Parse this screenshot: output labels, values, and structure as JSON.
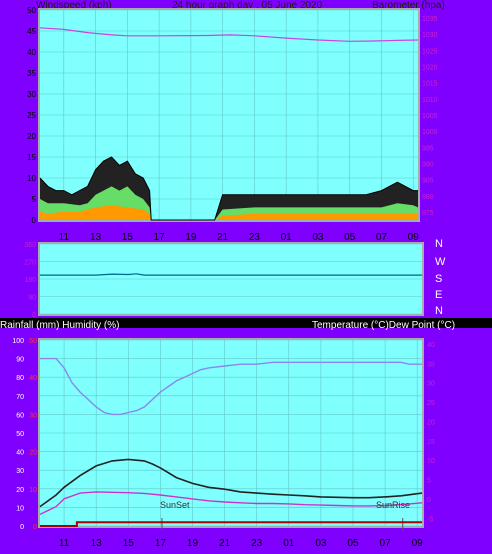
{
  "header": {
    "left": "Windspeed (kph)",
    "center": "24 hour graph day : 05 June 2020",
    "right": "Barometer (hpa)"
  },
  "dir_letters": [
    "N",
    "W",
    "S",
    "E",
    "N"
  ],
  "mid_header": {
    "left": "Rainfall (mm)  Humidity (%)",
    "right": "Temperature (°C)Dew Point (°C)"
  },
  "markers": {
    "sunset": "SunSet",
    "sunrise": "SunRise"
  },
  "colors": {
    "plot_bg": "#80ffff",
    "frame_bg": "#8000ff",
    "barometer": "#cc44dd",
    "wind_gust": "#000000",
    "wind_avg_green": "#66dd66",
    "wind_avg_orange": "#ff9900",
    "humidity": "#8888ee",
    "temperature": "#222222",
    "dewpoint": "#cc33cc",
    "rain": "#aa0000"
  },
  "chart_data": [
    {
      "type": "line",
      "title": "24 hour graph day : 05 June 2020",
      "ylabel": "Windspeed (kph)",
      "y2label": "Barometer (hpa)",
      "x_ticks": [
        "11",
        "13",
        "15",
        "17",
        "19",
        "21",
        "23",
        "01",
        "03",
        "05",
        "07",
        "09"
      ],
      "y_ticks": [
        "50",
        "45",
        "40",
        "35",
        "30",
        "25",
        "20",
        "15",
        "10",
        "5",
        "0"
      ],
      "y2_ticks": [
        "1035",
        "1030",
        "1025",
        "1020",
        "1015",
        "1010",
        "1005",
        "1000",
        "995",
        "990",
        "985",
        "980",
        "975"
      ],
      "ylim": [
        0,
        50
      ],
      "y2lim": [
        972.5,
        1037.5
      ],
      "grid": true,
      "series": [
        {
          "key": "barometer",
          "axis": "right",
          "x": [
            9.5,
            11,
            12.5,
            14,
            15,
            17,
            20,
            21.5,
            23,
            1,
            3,
            5,
            6.5,
            8,
            9.3
          ],
          "y": [
            1032,
            1031.5,
            1030.5,
            1029.8,
            1029.5,
            1029.5,
            1029.6,
            1029.8,
            1029.5,
            1028.8,
            1028.2,
            1027.8,
            1027.9,
            1028.1,
            1028.2
          ]
        },
        {
          "key": "wind_gust",
          "axis": "left",
          "x": [
            9.5,
            10,
            10.5,
            11,
            11.5,
            12,
            12.5,
            13,
            13.5,
            14,
            14.5,
            15,
            15.5,
            16,
            16.4,
            16.5,
            20.5,
            21,
            22,
            23,
            0,
            1,
            2,
            3,
            4,
            5,
            6,
            7,
            8,
            9,
            9.3
          ],
          "y": [
            10,
            8,
            7,
            7,
            6,
            7,
            8,
            12,
            14,
            15,
            13,
            14,
            11,
            10,
            7,
            0,
            0,
            6,
            6,
            6,
            6,
            6,
            6,
            6,
            6,
            6,
            6,
            7,
            9,
            7,
            7
          ]
        },
        {
          "key": "wind_avg_green",
          "axis": "left",
          "x": [
            9.5,
            10,
            11,
            12,
            12.5,
            13,
            13.5,
            14,
            14.5,
            15,
            15.5,
            16,
            16.4,
            16.5,
            20.5,
            21,
            23,
            1,
            3,
            5,
            7,
            8,
            9,
            9.3
          ],
          "y": [
            5,
            4,
            4,
            3.5,
            4,
            6,
            7,
            8,
            7,
            8,
            6,
            5,
            3,
            0,
            0,
            2.5,
            3,
            3,
            3,
            3,
            3,
            4,
            3.5,
            3
          ]
        },
        {
          "key": "wind_avg_orange",
          "axis": "left",
          "x": [
            9.5,
            10,
            11,
            12,
            13,
            14,
            15,
            16,
            16.4,
            16.5,
            20.5,
            21,
            23,
            1,
            3,
            5,
            7,
            9,
            9.3
          ],
          "y": [
            2,
            1.5,
            2,
            2,
            3,
            3.5,
            3,
            2.5,
            1.5,
            0,
            0,
            1,
            1.5,
            1.5,
            1.5,
            1.5,
            1.5,
            1.5,
            1.5
          ]
        }
      ]
    },
    {
      "type": "line",
      "ylabel": "Wind direction",
      "y_ticks": [
        "360",
        "270",
        "180",
        "90",
        "0"
      ],
      "ylim": [
        0,
        360
      ],
      "series": [
        {
          "key": "direction",
          "x": [
            9.5,
            13,
            14,
            15,
            15.5,
            16,
            17,
            21,
            1,
            5,
            9.3
          ],
          "y": [
            200,
            200,
            205,
            203,
            207,
            200,
            200,
            200,
            200,
            200,
            200
          ]
        }
      ]
    },
    {
      "type": "line",
      "ylabel": "Rainfall (mm)  Humidity (%)",
      "y2label": "Temperature (°C)Dew Point (°C)",
      "x_ticks": [
        "11",
        "13",
        "15",
        "17",
        "19",
        "21",
        "23",
        "01",
        "03",
        "05",
        "07",
        "09"
      ],
      "y_ticks": [
        "100",
        "90",
        "80",
        "70",
        "60",
        "50",
        "40",
        "30",
        "20",
        "10",
        "0"
      ],
      "rain_ticks": [
        "50",
        "40",
        "30",
        "20",
        "10",
        "0"
      ],
      "y2_ticks": [
        "40",
        "35",
        "30",
        "25",
        "20",
        "15",
        "10",
        "5",
        "0",
        "-5"
      ],
      "ylim": [
        0,
        100
      ],
      "y2lim": [
        -7,
        41
      ],
      "grid": true,
      "series": [
        {
          "key": "humidity",
          "axis": "left",
          "x": [
            9.5,
            10.5,
            11,
            11.5,
            12,
            12.5,
            13,
            13.5,
            14,
            14.5,
            15,
            15.5,
            16,
            16.5,
            17,
            17.5,
            18,
            18.5,
            19,
            19.5,
            20,
            21,
            22,
            23,
            0,
            1,
            2,
            3,
            4,
            5,
            6,
            7,
            8,
            8.5,
            9.3
          ],
          "y": [
            90,
            90,
            85,
            77,
            72,
            68,
            64,
            61,
            60,
            60,
            61,
            62,
            64,
            68,
            72,
            75,
            78,
            80,
            82,
            84,
            85,
            86,
            87,
            87,
            88,
            88,
            88,
            88,
            88,
            88,
            88,
            88,
            88,
            87,
            87
          ]
        },
        {
          "key": "temperature",
          "axis": "right",
          "x": [
            9.5,
            10.5,
            11,
            12,
            13,
            14,
            15,
            16,
            16.5,
            17,
            18,
            19,
            20,
            21,
            22,
            23,
            0,
            1,
            2,
            3,
            4,
            5,
            6,
            7,
            8,
            9.3
          ],
          "y": [
            -2,
            1,
            3,
            6,
            8.5,
            9.8,
            10.2,
            9.8,
            9,
            8,
            5.5,
            4,
            3,
            2.5,
            1.8,
            1.5,
            1.2,
            1,
            0.8,
            0.5,
            0.4,
            0.3,
            0.3,
            0.5,
            0.8,
            1.5
          ]
        },
        {
          "key": "dewpoint",
          "axis": "right",
          "x": [
            9.5,
            10.5,
            11,
            12,
            13,
            14,
            15,
            16,
            17,
            18,
            19,
            20,
            21,
            22,
            23,
            0,
            1,
            2,
            3,
            4,
            5,
            6,
            7,
            8,
            9.3
          ],
          "y": [
            -4,
            -2,
            0,
            1.5,
            1.8,
            1.7,
            1.6,
            1.4,
            1,
            0.5,
            0,
            -0.5,
            -0.8,
            -1,
            -1.2,
            -1.2,
            -1.3,
            -1.5,
            -1.6,
            -1.7,
            -1.8,
            -1.8,
            -1.7,
            -1.5,
            -1
          ]
        },
        {
          "key": "rain",
          "axis": "rain",
          "x": [
            9.5,
            11.8,
            11.8,
            9.3
          ],
          "y": [
            0,
            0,
            1,
            1
          ]
        }
      ]
    }
  ]
}
